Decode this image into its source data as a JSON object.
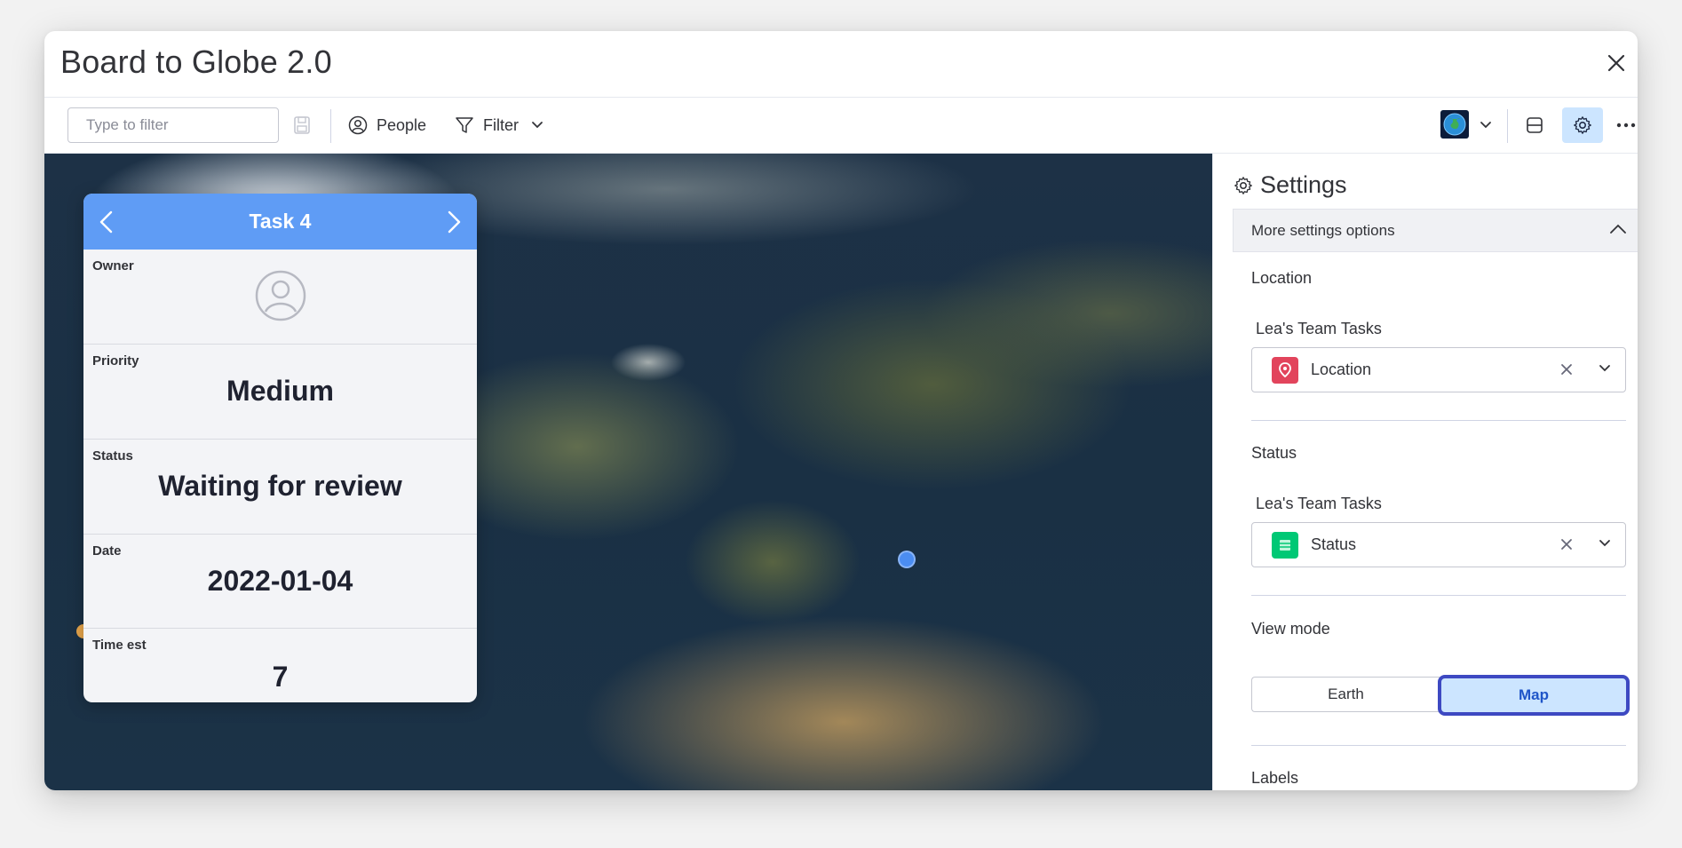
{
  "window": {
    "title": "Board to Globe 2.0"
  },
  "toolbar": {
    "search_placeholder": "Type to filter",
    "people_label": "People",
    "filter_label": "Filter"
  },
  "card": {
    "title": "Task 4",
    "rows": [
      {
        "label": "Owner",
        "value": ""
      },
      {
        "label": "Priority",
        "value": "Medium"
      },
      {
        "label": "Status",
        "value": "Waiting for review"
      },
      {
        "label": "Date",
        "value": "2022-01-04"
      },
      {
        "label": "Time est",
        "value": "7"
      }
    ]
  },
  "settings": {
    "title": "Settings",
    "more_options": "More settings options",
    "location": {
      "section": "Location",
      "board": "Lea's Team Tasks",
      "column": "Location",
      "icon_color": "#e2445c"
    },
    "status": {
      "section": "Status",
      "board": "Lea's Team Tasks",
      "column": "Status",
      "icon_color": "#00c875"
    },
    "view_mode": {
      "section": "View mode",
      "options": [
        "Earth",
        "Map"
      ],
      "selected": "Map"
    },
    "labels_section": "Labels"
  },
  "colors": {
    "accent": "#5f9cf5",
    "selected_toggle_bg": "#cce5ff",
    "selected_toggle_border": "#3d49c2"
  }
}
